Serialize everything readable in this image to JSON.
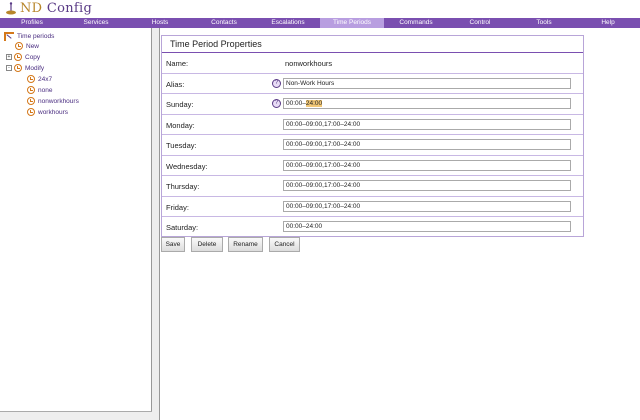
{
  "app": {
    "title_prefix": "ND",
    "title_suffix": "Config"
  },
  "nav": {
    "items": [
      {
        "label": "Profiles"
      },
      {
        "label": "Services"
      },
      {
        "label": "Hosts"
      },
      {
        "label": "Contacts"
      },
      {
        "label": "Escalations"
      },
      {
        "label": "Time Periods",
        "active": true
      },
      {
        "label": "Commands"
      },
      {
        "label": "Control"
      },
      {
        "label": "Tools"
      },
      {
        "label": "Help"
      }
    ]
  },
  "tree": {
    "root": "Time periods",
    "new": "New",
    "copy": "Copy",
    "modify": "Modify",
    "copy_expander": "+",
    "modify_expander": "-",
    "items": [
      "24x7",
      "none",
      "nonworkhours",
      "workhours"
    ]
  },
  "panel": {
    "title": "Time Period Properties",
    "help_glyph": "?",
    "name": {
      "label": "Name:",
      "value": "nonworkhours"
    },
    "alias": {
      "label": "Alias:",
      "value": "Non-Work Hours"
    },
    "sunday": {
      "label": "Sunday:",
      "value_plain": "00:00–",
      "value_selected": "24:00"
    },
    "monday": {
      "label": "Monday:",
      "value": "00:00–09:00,17:00–24:00"
    },
    "tuesday": {
      "label": "Tuesday:",
      "value": "00:00–09:00,17:00–24:00"
    },
    "wednesday": {
      "label": "Wednesday:",
      "value": "00:00–09:00,17:00–24:00"
    },
    "thursday": {
      "label": "Thursday:",
      "value": "00:00–09:00,17:00–24:00"
    },
    "friday": {
      "label": "Friday:",
      "value": "00:00–09:00,17:00–24:00"
    },
    "saturday": {
      "label": "Saturday:",
      "value": "00:00–24:00"
    }
  },
  "buttons": {
    "save": "Save",
    "delete": "Delete",
    "rename": "Rename",
    "cancel": "Cancel"
  },
  "colors": {
    "nav": "#7a4fb0",
    "nav_active": "#b89ee0",
    "accent": "#5a3b86",
    "tree_icon": "#d4781a",
    "selection": "#f2c877"
  }
}
